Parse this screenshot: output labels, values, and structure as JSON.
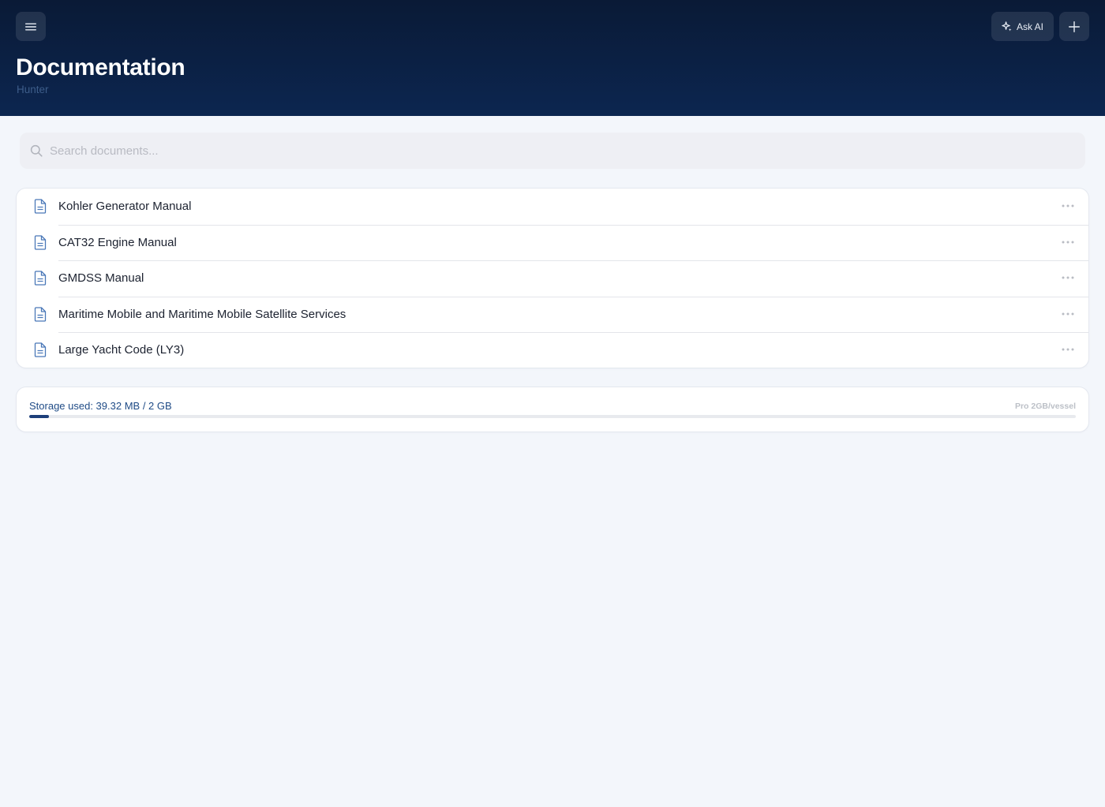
{
  "header": {
    "title": "Documentation",
    "subtitle": "Hunter",
    "ask_ai_label": "Ask AI"
  },
  "search": {
    "placeholder": "Search documents...",
    "value": ""
  },
  "documents": [
    {
      "title": "Kohler Generator Manual"
    },
    {
      "title": "CAT32 Engine Manual"
    },
    {
      "title": "GMDSS Manual"
    },
    {
      "title": "Maritime Mobile and Maritime Mobile Satellite Services"
    },
    {
      "title": "Large Yacht Code (LY3)"
    }
  ],
  "storage": {
    "label": "Storage used: 39.32 MB / 2 GB",
    "plan": "Pro 2GB/vessel",
    "used_fraction": 0.0192
  },
  "icons": {
    "menu": "hamburger-menu-icon",
    "ask_ai": "sparkle-icon",
    "add": "plus-icon",
    "search": "search-icon",
    "document": "document-icon",
    "more": "more-horizontal-icon"
  },
  "colors": {
    "header_top": "#0a1a36",
    "header_bottom": "#0c2650",
    "accent": "#1d3f7a",
    "document_icon": "#4a78b8",
    "storage_text": "#1f4b86"
  }
}
